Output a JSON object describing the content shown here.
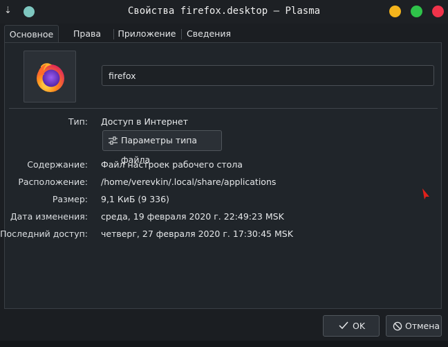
{
  "window": {
    "title": "Свойства firefox.desktop — Plasma"
  },
  "tabs": [
    {
      "label": "Основное",
      "active": true
    },
    {
      "label": "Права",
      "active": false
    },
    {
      "label": "Приложение",
      "active": false
    },
    {
      "label": "Сведения",
      "active": false
    }
  ],
  "general": {
    "name_value": "firefox",
    "icon": "firefox-icon",
    "rows": {
      "type_label": "Тип:",
      "type_value": "Доступ в Интернет",
      "filetype_button": "Параметры типа файла",
      "content_label": "Содержание:",
      "content_value": "Файл настроек рабочего стола",
      "location_label": "Расположение:",
      "location_value": "/home/verevkin/.local/share/applications",
      "size_label": "Размер:",
      "size_value": "9,1 КиБ (9 336)",
      "modified_label": "Дата изменения:",
      "modified_value": "среда, 19 февраля 2020 г. 22:49:23 MSK",
      "accessed_label": "Последний доступ:",
      "accessed_value": "четверг, 27 февраля 2020 г. 17:30:45 MSK"
    }
  },
  "buttons": {
    "ok": "OK",
    "cancel": "Отмена"
  },
  "colors": {
    "minimize": "#f4b41c",
    "maximize": "#2fc34a",
    "close": "#f0334a"
  }
}
